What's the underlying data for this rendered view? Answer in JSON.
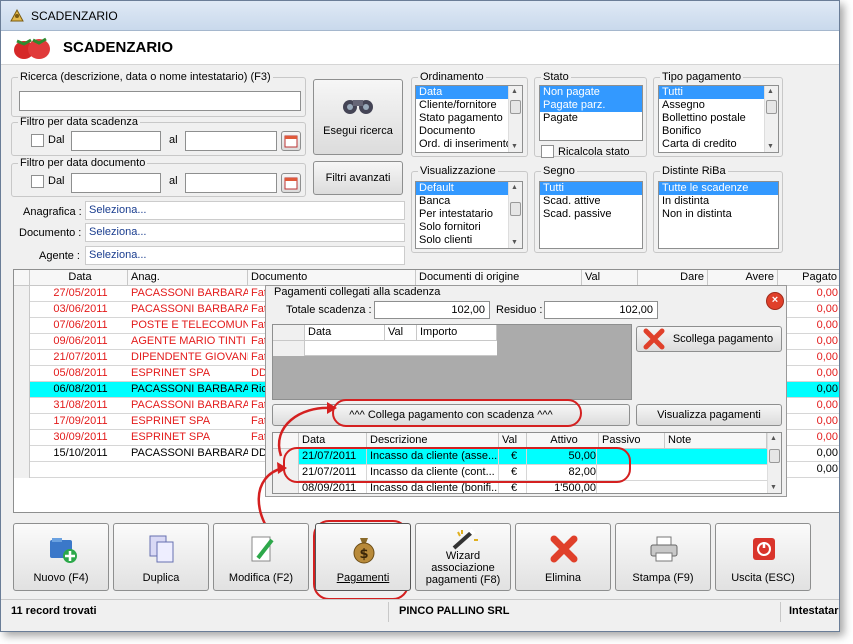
{
  "window": {
    "title": "SCADENZARIO"
  },
  "header": {
    "title": "SCADENZARIO"
  },
  "search": {
    "legend": "Ricerca (descrizione, data o nome intestatario) (F3)",
    "value": "",
    "button": "Esegui ricerca"
  },
  "filter_scadenza": {
    "legend": "Filtro per data scadenza",
    "dal": "Dal",
    "al": "al"
  },
  "filter_documento": {
    "legend": "Filtro per data documento",
    "dal": "Dal",
    "al": "al",
    "button": "Filtri avanzati"
  },
  "fields": {
    "anagrafica": {
      "label": "Anagrafica :",
      "value": "Seleziona..."
    },
    "documento": {
      "label": "Documento :",
      "value": "Seleziona..."
    },
    "agente": {
      "label": "Agente :",
      "value": "Seleziona..."
    }
  },
  "ordinamento": {
    "legend": "Ordinamento",
    "items": [
      "Data",
      "Cliente/fornitore",
      "Stato pagamento",
      "Documento",
      "Ord. di inserimento"
    ],
    "selected": 0
  },
  "stato": {
    "legend": "Stato",
    "items": [
      "Non pagate",
      "Pagate parz.",
      "Pagate"
    ],
    "selected": [
      0,
      1
    ],
    "ricalcola": "Ricalcola stato"
  },
  "tipo_pagamento": {
    "legend": "Tipo pagamento",
    "items": [
      "Tutti",
      "Assegno",
      "Bollettino postale",
      "Bonifico",
      "Carta di credito"
    ],
    "selected": 0
  },
  "visualizzazione": {
    "legend": "Visualizzazione",
    "items": [
      "Default",
      "Banca",
      "Per intestatario",
      "Solo fornitori",
      "Solo clienti"
    ],
    "selected": 0
  },
  "segno": {
    "legend": "Segno",
    "items": [
      "Tutti",
      "Scad. attive",
      "Scad. passive"
    ],
    "selected": 0
  },
  "distinte": {
    "legend": "Distinte RiBa",
    "items": [
      "Tutte le scadenze",
      "In distinta",
      "Non in distinta"
    ],
    "selected": 0
  },
  "grid": {
    "headers": [
      "Data",
      "Anag.",
      "Documento",
      "Documenti di origine",
      "Val",
      "Dare",
      "Avere",
      "Pagato"
    ],
    "rows": [
      {
        "data": "27/05/2011",
        "anag": "PACASSONI BARBARA",
        "doc": "Fat",
        "pagato": "0,00",
        "style": "red"
      },
      {
        "data": "03/06/2011",
        "anag": "PACASSONI BARBARA",
        "doc": "Fat",
        "pagato": "0,00",
        "style": "red"
      },
      {
        "data": "07/06/2011",
        "anag": "POSTE E TELECOMUN...",
        "doc": "Fat",
        "pagato": "0,00",
        "style": "red"
      },
      {
        "data": "09/06/2011",
        "anag": "AGENTE MARIO TINTI",
        "doc": "Fat",
        "pagato": "0,00",
        "style": "red"
      },
      {
        "data": "21/07/2011",
        "anag": "DIPENDENTE GIOVANNI",
        "doc": "Fat",
        "pagato": "0,00",
        "style": "red"
      },
      {
        "data": "05/08/2011",
        "anag": "ESPRINET SPA",
        "doc": "DD",
        "pagato": "0,00",
        "style": "red"
      },
      {
        "data": "06/08/2011",
        "anag": "PACASSONI BARBARA",
        "doc": "Ric",
        "pagato": "0,00",
        "style": "selected"
      },
      {
        "data": "31/08/2011",
        "anag": "PACASSONI BARBARA",
        "doc": "Fat",
        "pagato": "0,00",
        "style": "red"
      },
      {
        "data": "17/09/2011",
        "anag": "ESPRINET SPA",
        "doc": "Fat",
        "pagato": "0,00",
        "style": "red"
      },
      {
        "data": "30/09/2011",
        "anag": "ESPRINET SPA",
        "doc": "Fat",
        "pagato": "0,00",
        "style": "red"
      },
      {
        "data": "15/10/2011",
        "anag": "PACASSONI BARBARA",
        "doc": "DD",
        "pagato": "0,00",
        "style": "black"
      },
      {
        "data": "",
        "anag": "",
        "doc": "",
        "pagato": "0,00",
        "style": "black"
      }
    ]
  },
  "popup": {
    "legend": "Pagamenti collegati alla scadenza",
    "totale_label": "Totale scadenza :",
    "totale_value": "102,00",
    "residuo_label": "Residuo :",
    "residuo_value": "102,00",
    "linked_headers": [
      "Data",
      "Val",
      "Importo"
    ],
    "scollega": "Scollega pagamento",
    "collega": "^^^ Collega pagamento con scadenza ^^^",
    "visualizza": "Visualizza pagamenti",
    "pay_headers": [
      "Data",
      "Descrizione",
      "Val",
      "Attivo",
      "Passivo",
      "Note"
    ],
    "payments": [
      {
        "data": "21/07/2011",
        "desc": "Incasso da cliente (asse...",
        "val": "€",
        "attivo": "50,00",
        "sel": true
      },
      {
        "data": "21/07/2011",
        "desc": "Incasso da cliente (cont...",
        "val": "€",
        "attivo": "82,00",
        "sel": false
      },
      {
        "data": "08/09/2011",
        "desc": "Incasso da cliente (bonifi...",
        "val": "€",
        "attivo": "1'500,00",
        "sel": false
      }
    ]
  },
  "toolbar": {
    "nuovo": "Nuovo (F4)",
    "duplica": "Duplica",
    "modifica": "Modifica (F2)",
    "pagamenti": "Pagamenti",
    "wizard": "Wizard associazione pagamenti (F8)",
    "elimina": "Elimina",
    "stampa": "Stampa (F9)",
    "uscita": "Uscita (ESC)"
  },
  "status": {
    "records": "11 record trovati",
    "company": "PINCO PALLINO SRL",
    "right": "Intestatar"
  },
  "colors": {
    "selected_row": "#00ffff",
    "overdue_text": "#e31b1b",
    "list_selection": "#3399ff",
    "annotation": "#d42020"
  }
}
